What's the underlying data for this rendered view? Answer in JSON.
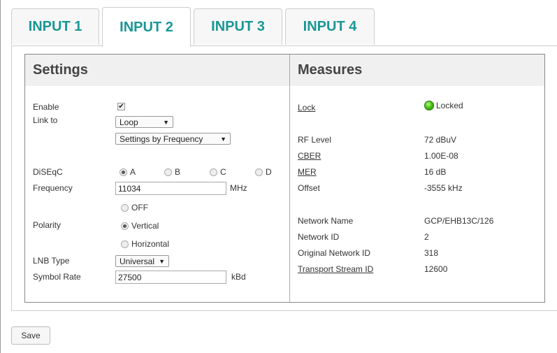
{
  "tabs": [
    {
      "label": "INPUT 1",
      "active": false
    },
    {
      "label": "INPUT 2",
      "active": true
    },
    {
      "label": "INPUT 3",
      "active": false
    },
    {
      "label": "INPUT 4",
      "active": false
    }
  ],
  "colors": {
    "tab_text": "#1a9696",
    "header_bg": "#f0f0f0",
    "lock_led": "#49c41a"
  },
  "settings": {
    "title": "Settings",
    "enable_label": "Enable",
    "enable_checked": true,
    "link_label": "Link to",
    "link_value": "Loop",
    "link_mode_value": "Settings by Frequency",
    "diseqc_label": "DiSEqC",
    "diseqc_options": [
      "A",
      "B",
      "C",
      "D"
    ],
    "diseqc_selected": "A",
    "frequency_label": "Frequency",
    "frequency_value": "11034",
    "frequency_unit": "MHz",
    "polarity_label": "Polarity",
    "polarity_options": [
      "OFF",
      "Vertical",
      "Horizontal"
    ],
    "polarity_selected": "Vertical",
    "lnb_label": "LNB Type",
    "lnb_value": "Universal",
    "symbol_label": "Symbol Rate",
    "symbol_value": "27500",
    "symbol_unit": "kBd"
  },
  "measures": {
    "title": "Measures",
    "lock_label": "Lock",
    "lock_value": "Locked",
    "rf_label": "RF Level",
    "rf_value": "72 dBuV",
    "cber_label": "CBER",
    "cber_value": "1.00E-08",
    "mer_label": "MER",
    "mer_value": "16 dB",
    "offset_label": "Offset",
    "offset_value": "-3555 kHz",
    "network_name_label": "Network Name",
    "network_name_value": "GCP/EHB13C/126",
    "network_id_label": "Network ID",
    "network_id_value": "2",
    "orig_network_id_label": "Original Network ID",
    "orig_network_id_value": "318",
    "ts_id_label": "Transport Stream ID",
    "ts_id_value": "12600"
  },
  "save_label": "Save"
}
